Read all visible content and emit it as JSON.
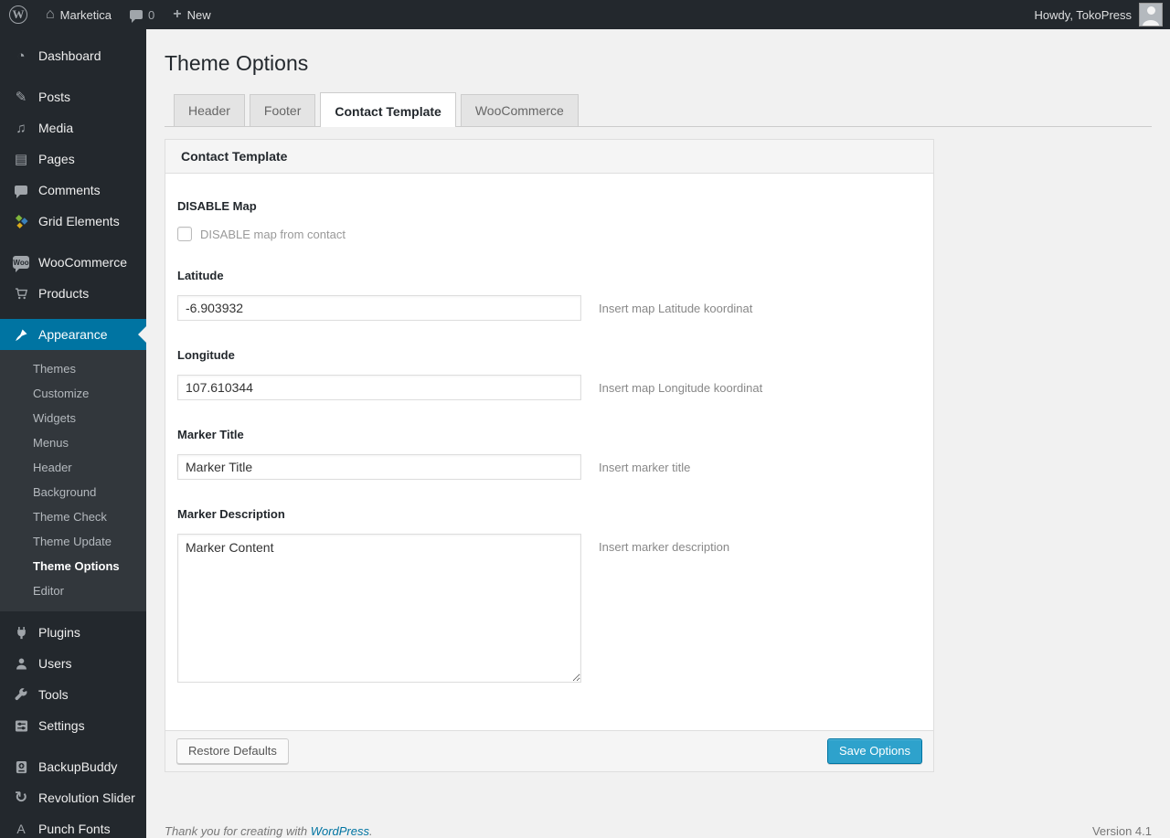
{
  "colors": {
    "admin_bar_bg": "#23282d",
    "sidebar_bg": "#23282d",
    "sidebar_submenu_bg": "#32373c",
    "sidebar_active_bg": "#0074a2",
    "page_bg": "#f1f1f1",
    "panel_header_bg": "#f5f5f5",
    "primary_button_bg": "#2ea2cc",
    "primary_button_border": "#0074a2",
    "link": "#0074a2"
  },
  "icons": {
    "wordpress_logo": "W",
    "home": "⌂",
    "plus": "+",
    "dashboard": "◔",
    "posts": "✎",
    "media": "♫",
    "pages": "▤",
    "woo_badge": "Woo",
    "revolution_slider": "↻",
    "punch_fonts": "A"
  },
  "admin_bar": {
    "site_name": "Marketica",
    "comments_count": "0",
    "new_label": "New",
    "howdy": "Howdy, TokoPress"
  },
  "sidebar": {
    "menu": [
      {
        "label": "Dashboard"
      },
      {
        "label": "Posts"
      },
      {
        "label": "Media"
      },
      {
        "label": "Pages"
      },
      {
        "label": "Comments"
      },
      {
        "label": "Grid Elements"
      },
      {
        "label": "WooCommerce"
      },
      {
        "label": "Products"
      },
      {
        "label": "Appearance",
        "active": true
      },
      {
        "label": "Plugins"
      },
      {
        "label": "Users"
      },
      {
        "label": "Tools"
      },
      {
        "label": "Settings"
      },
      {
        "label": "BackupBuddy"
      },
      {
        "label": "Revolution Slider"
      },
      {
        "label": "Punch Fonts"
      }
    ],
    "submenu": [
      "Themes",
      "Customize",
      "Widgets",
      "Menus",
      "Header",
      "Background",
      "Theme Check",
      "Theme Update",
      "Theme Options",
      "Editor"
    ],
    "submenu_current": "Theme Options"
  },
  "page": {
    "title": "Theme Options",
    "tabs": [
      {
        "label": "Header",
        "active": false
      },
      {
        "label": "Footer",
        "active": false
      },
      {
        "label": "Contact Template",
        "active": true
      },
      {
        "label": "WooCommerce",
        "active": false
      }
    ],
    "panel_header": "Contact Template",
    "fields": {
      "disable_map": {
        "label": "DISABLE Map",
        "checkbox_label": "DISABLE map from contact",
        "checked": false
      },
      "latitude": {
        "label": "Latitude",
        "value": "-6.903932",
        "hint": "Insert map Latitude koordinat"
      },
      "longitude": {
        "label": "Longitude",
        "value": "107.610344",
        "hint": "Insert map Longitude koordinat"
      },
      "marker_title": {
        "label": "Marker Title",
        "value": "Marker Title",
        "hint": "Insert marker title"
      },
      "marker_description": {
        "label": "Marker Description",
        "value": "Marker Content",
        "hint": "Insert marker description"
      }
    },
    "buttons": {
      "restore": "Restore Defaults",
      "save": "Save Options"
    },
    "footer": {
      "thanks_text": "Thank you for creating with",
      "link_label": "WordPress",
      "period": ".",
      "version": "Version 4.1"
    }
  }
}
